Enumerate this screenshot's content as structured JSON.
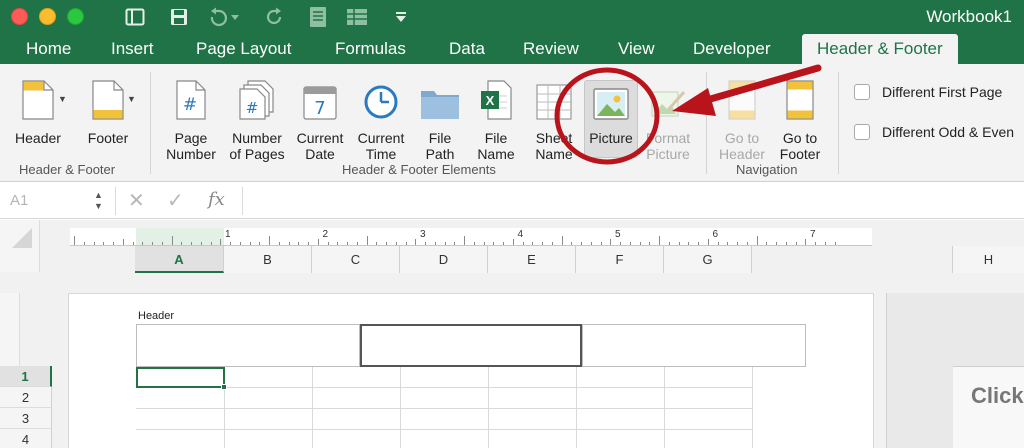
{
  "window": {
    "title": "Workbook1"
  },
  "tabs": [
    {
      "label": "Home"
    },
    {
      "label": "Insert"
    },
    {
      "label": "Page Layout"
    },
    {
      "label": "Formulas"
    },
    {
      "label": "Data"
    },
    {
      "label": "Review"
    },
    {
      "label": "View"
    },
    {
      "label": "Developer"
    },
    {
      "label": "Header & Footer"
    }
  ],
  "ribbon": {
    "groups": {
      "header_footer": "Header & Footer",
      "elements": "Header & Footer Elements",
      "navigation": "Navigation"
    },
    "buttons": {
      "header": "Header",
      "footer": "Footer",
      "page_number": "Page\nNumber",
      "number_of_pages": "Number\nof Pages",
      "current_date": "Current\nDate",
      "current_time": "Current\nTime",
      "file_path": "File\nPath",
      "file_name": "File\nName",
      "sheet_name": "Sheet\nName",
      "picture": "Picture",
      "format_picture": "Format\nPicture",
      "go_to_header": "Go to\nHeader",
      "go_to_footer": "Go to\nFooter"
    },
    "options": {
      "different_first_page": "Different First Page",
      "different_odd_even": "Different Odd & Even"
    },
    "date_icon_number": "7",
    "page_number_icon_text": "#"
  },
  "formula_bar": {
    "name_box": "A1",
    "fx": "fx"
  },
  "ruler": {
    "numbers": [
      "1",
      "2",
      "3",
      "4",
      "5",
      "6",
      "7"
    ]
  },
  "columns": [
    "A",
    "B",
    "C",
    "D",
    "E",
    "F",
    "G"
  ],
  "column_h": "H",
  "rows": [
    "1",
    "2",
    "3",
    "4"
  ],
  "page": {
    "header_label": "Header"
  },
  "next_page": {
    "click_text": "Click"
  },
  "colors": {
    "brand_green": "#1f7346",
    "annotation_red": "#b9141b"
  }
}
